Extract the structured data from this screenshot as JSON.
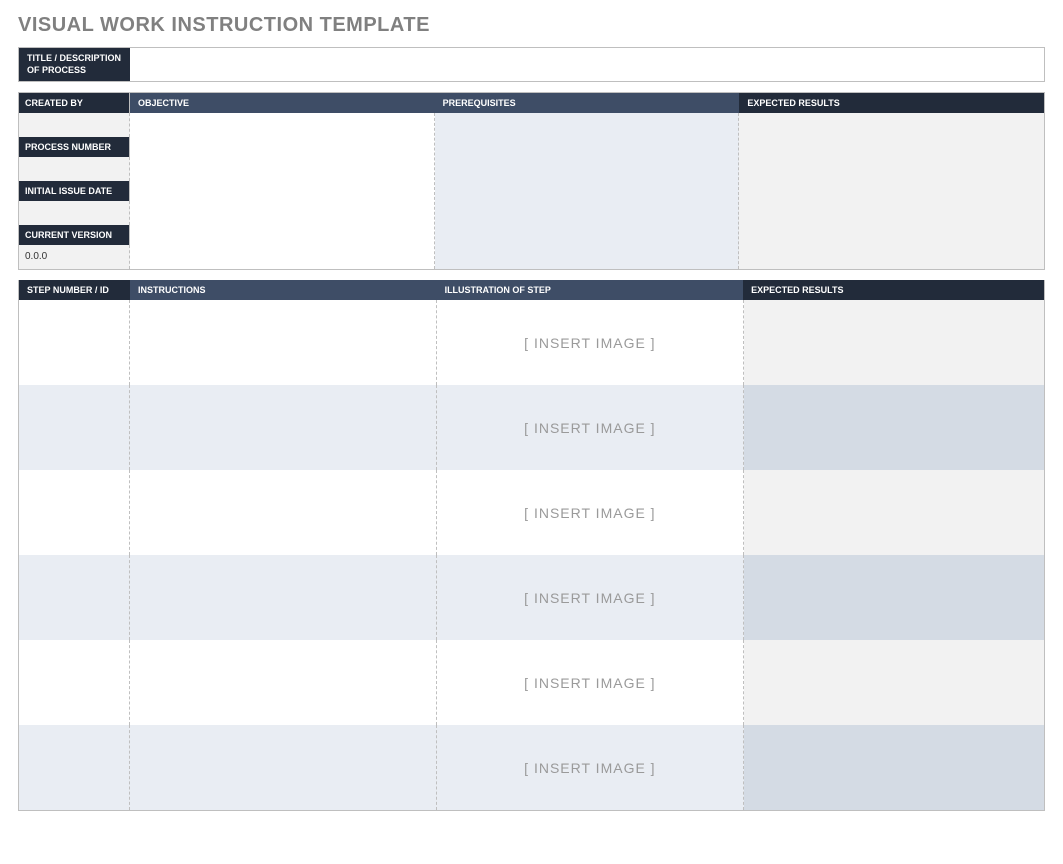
{
  "page_title": "VISUAL WORK INSTRUCTION TEMPLATE",
  "title_row": {
    "label": "TITLE / DESCRIPTION OF  PROCESS",
    "value": ""
  },
  "meta": {
    "created_by": {
      "label": "CREATED BY",
      "value": ""
    },
    "process_number": {
      "label": "PROCESS NUMBER",
      "value": ""
    },
    "initial_issue_date": {
      "label": "INITIAL ISSUE DATE",
      "value": ""
    },
    "current_version": {
      "label": "CURRENT VERSION",
      "value": "0.0.0"
    }
  },
  "info_cols": {
    "objective": {
      "label": "OBJECTIVE",
      "value": ""
    },
    "prerequisites": {
      "label": "PREREQUISITES",
      "value": ""
    },
    "expected_results": {
      "label": "EXPECTED RESULTS",
      "value": ""
    }
  },
  "steps_header": {
    "step": "STEP NUMBER / ID",
    "instructions": "INSTRUCTIONS",
    "illustration": "ILLUSTRATION OF STEP",
    "expected": "EXPECTED RESULTS"
  },
  "insert_image_text": "[  INSERT IMAGE  ]",
  "steps": [
    {
      "step": "",
      "instructions": "",
      "expected": ""
    },
    {
      "step": "",
      "instructions": "",
      "expected": ""
    },
    {
      "step": "",
      "instructions": "",
      "expected": ""
    },
    {
      "step": "",
      "instructions": "",
      "expected": ""
    },
    {
      "step": "",
      "instructions": "",
      "expected": ""
    },
    {
      "step": "",
      "instructions": "",
      "expected": ""
    }
  ]
}
